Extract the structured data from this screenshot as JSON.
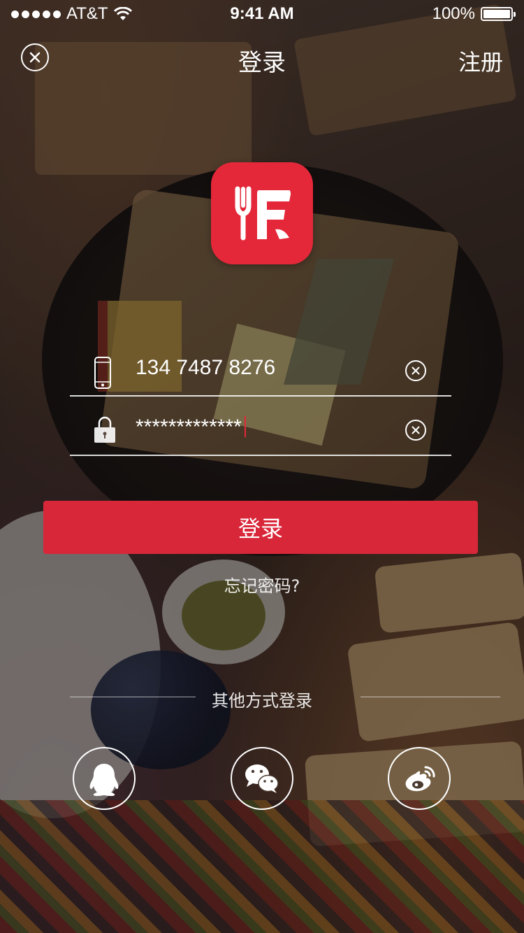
{
  "status_bar": {
    "carrier": "AT&T",
    "time": "9:41 AM",
    "battery": "100%",
    "battery_level": 1.0
  },
  "nav": {
    "title": "登录",
    "register_label": "注册",
    "close_icon": "close-circle-icon"
  },
  "logo": {
    "icon": "fork-f-logo-icon",
    "color": "#e4283a"
  },
  "form": {
    "phone_value": "134 7487 8276",
    "phone_icon": "phone-icon",
    "password_value": "*************",
    "password_icon": "lock-icon",
    "clear_icon": "clear-icon"
  },
  "login_button": {
    "label": "登录",
    "color": "#d9273a"
  },
  "forgot_password": "忘记密码?",
  "other_login": {
    "label": "其他方式登录",
    "options": [
      {
        "name": "qq",
        "icon": "qq-icon"
      },
      {
        "name": "wechat",
        "icon": "wechat-icon"
      },
      {
        "name": "weibo",
        "icon": "weibo-icon"
      }
    ]
  }
}
